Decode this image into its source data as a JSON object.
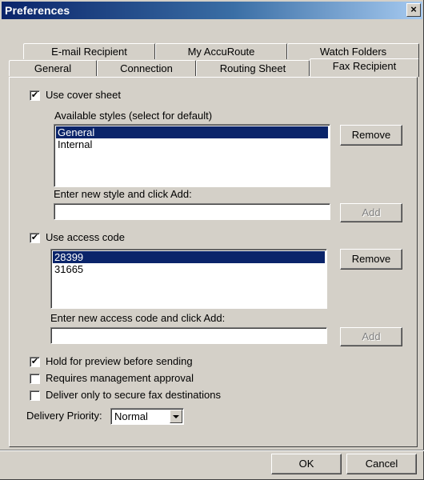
{
  "window": {
    "title": "Preferences",
    "close_glyph": "×"
  },
  "tabs": {
    "row1": [
      "E-mail Recipient",
      "My AccuRoute",
      "Watch Folders"
    ],
    "row2": [
      "General",
      "Connection",
      "Routing Sheet",
      "Fax Recipient"
    ],
    "active": "Fax Recipient"
  },
  "cover_sheet": {
    "checkbox_label": "Use cover sheet",
    "checked": true,
    "styles_label": "Available styles (select for default)",
    "styles": [
      "General",
      "Internal"
    ],
    "selected_style": "General",
    "remove_label": "Remove",
    "new_style_label": "Enter new style and click Add:",
    "new_style_value": "",
    "add_label": "Add"
  },
  "access_code": {
    "checkbox_label": "Use access code",
    "checked": true,
    "codes": [
      "28399",
      "31665"
    ],
    "selected_code": "28399",
    "remove_label": "Remove",
    "new_code_label": "Enter new access code and click Add:",
    "new_code_value": "",
    "add_label": "Add"
  },
  "options": {
    "hold_preview": {
      "label": "Hold for preview before sending",
      "checked": true
    },
    "mgmt_approval": {
      "label": "Requires management approval",
      "checked": false
    },
    "secure_only": {
      "label": "Deliver only to secure fax destinations",
      "checked": false
    }
  },
  "delivery_priority": {
    "label": "Delivery Priority:",
    "value": "Normal"
  },
  "footer": {
    "ok_label": "OK",
    "cancel_label": "Cancel"
  },
  "check_glyph": "✔",
  "colors": {
    "selection": "#0a246a",
    "face": "#d4d0c8",
    "title_start": "#0a246a"
  }
}
